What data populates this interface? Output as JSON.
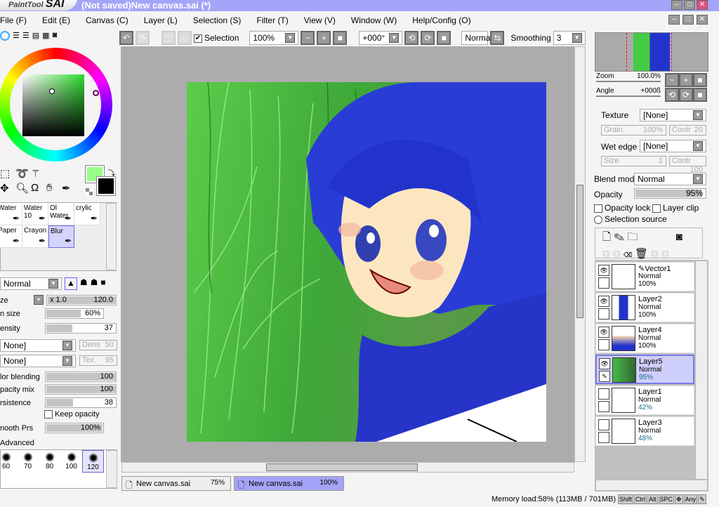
{
  "app": {
    "logo": "PaintTool SAI",
    "title": "(Not saved)New canvas.sai (*)"
  },
  "menu": [
    "File (F)",
    "Edit (E)",
    "Canvas (C)",
    "Layer (L)",
    "Selection (S)",
    "Filter (T)",
    "View (V)",
    "Window (W)",
    "Help/Config (O)"
  ],
  "toolbar": {
    "selection_label": "Selection",
    "selection_checked": true,
    "zoom": "100%",
    "angle": "+000°",
    "mode": "Normal",
    "smoothing_label": "Smoothing",
    "smoothing": "3"
  },
  "colors": {
    "primary": "#99ff88",
    "secondary": "#000000",
    "accent": "#a4a4f8"
  },
  "brushes": [
    {
      "name": "Water",
      "sub": ""
    },
    {
      "name": "Water",
      "sub": "10"
    },
    {
      "name": "Ol Water",
      "sub": ""
    },
    {
      "name": "crylic",
      "sub": ""
    },
    {
      "name": "Paper",
      "sub": ""
    },
    {
      "name": "Crayon",
      "sub": ""
    },
    {
      "name": "Blur",
      "sub": "",
      "selected": true
    }
  ],
  "brush_settings": {
    "mode": "Normal",
    "size_label": "ze",
    "size_mult": "x 1.0",
    "size": "120.0",
    "min_size_label": "n size",
    "min_size": "60%",
    "density_label": "ensity",
    "density": "37",
    "shape1": "None]",
    "dens_label": "Dens",
    "dens": "50",
    "shape2": "None]",
    "tex_label": "Tex.",
    "tex": "95",
    "color_blending_label": "lor blending",
    "color_blending": "100",
    "opacity_mix_label": "pacity mix",
    "opacity_mix": "100",
    "persistence_label": "rsistence",
    "persistence": "38",
    "keep_opacity": "Keep opacity",
    "smooth_prs_label": "nooth Prs",
    "smooth_prs": "100%",
    "advanced": "Advanced",
    "dot_sizes": [
      "60",
      "70",
      "80",
      "100",
      "120"
    ]
  },
  "navigator": {
    "zoom_label": "Zoom",
    "zoom": "100.0%",
    "angle_label": "Angle",
    "angle": "+000ß"
  },
  "layer_settings": {
    "texture_label": "Texture",
    "texture": "[None]",
    "grain_label": "Grain",
    "grain": "100%",
    "contr_label": "Contr",
    "contr": "20",
    "wet_edge_label": "Wet edge",
    "wet_edge": "[None]",
    "size_label": "Size",
    "size": "1",
    "contr2": "100",
    "blend_mode_label": "Blend mode",
    "blend_mode": "Normal",
    "opacity_label": "Opacity",
    "opacity": "95%",
    "opacity_lock": "Opacity lock",
    "layer_clip": "Layer clip",
    "selection_source": "Selection source"
  },
  "layers": [
    {
      "name": "Vector1",
      "mode": "Normal",
      "opacity": "100%",
      "visible": true,
      "vector": true
    },
    {
      "name": "Layer2",
      "mode": "Normal",
      "opacity": "100%",
      "visible": true
    },
    {
      "name": "Layer4",
      "mode": "Normal",
      "opacity": "100%",
      "visible": true
    },
    {
      "name": "Layer5",
      "mode": "Normal",
      "opacity": "95%",
      "visible": true,
      "selected": true
    },
    {
      "name": "Layer1",
      "mode": "Normal",
      "opacity": "42%",
      "visible": false
    },
    {
      "name": "Layer3",
      "mode": "Normal",
      "opacity": "48%",
      "visible": false
    }
  ],
  "tabs": [
    {
      "name": "New canvas.sai",
      "zoom": "75%"
    },
    {
      "name": "New canvas.sai",
      "zoom": "100%",
      "selected": true
    }
  ],
  "status": {
    "memory": "Memory load:58% (113MB / 701MB)",
    "keys": [
      "Shift",
      "Ctrl",
      "Alt",
      "SPC",
      "✥",
      "Any",
      "✎"
    ]
  }
}
